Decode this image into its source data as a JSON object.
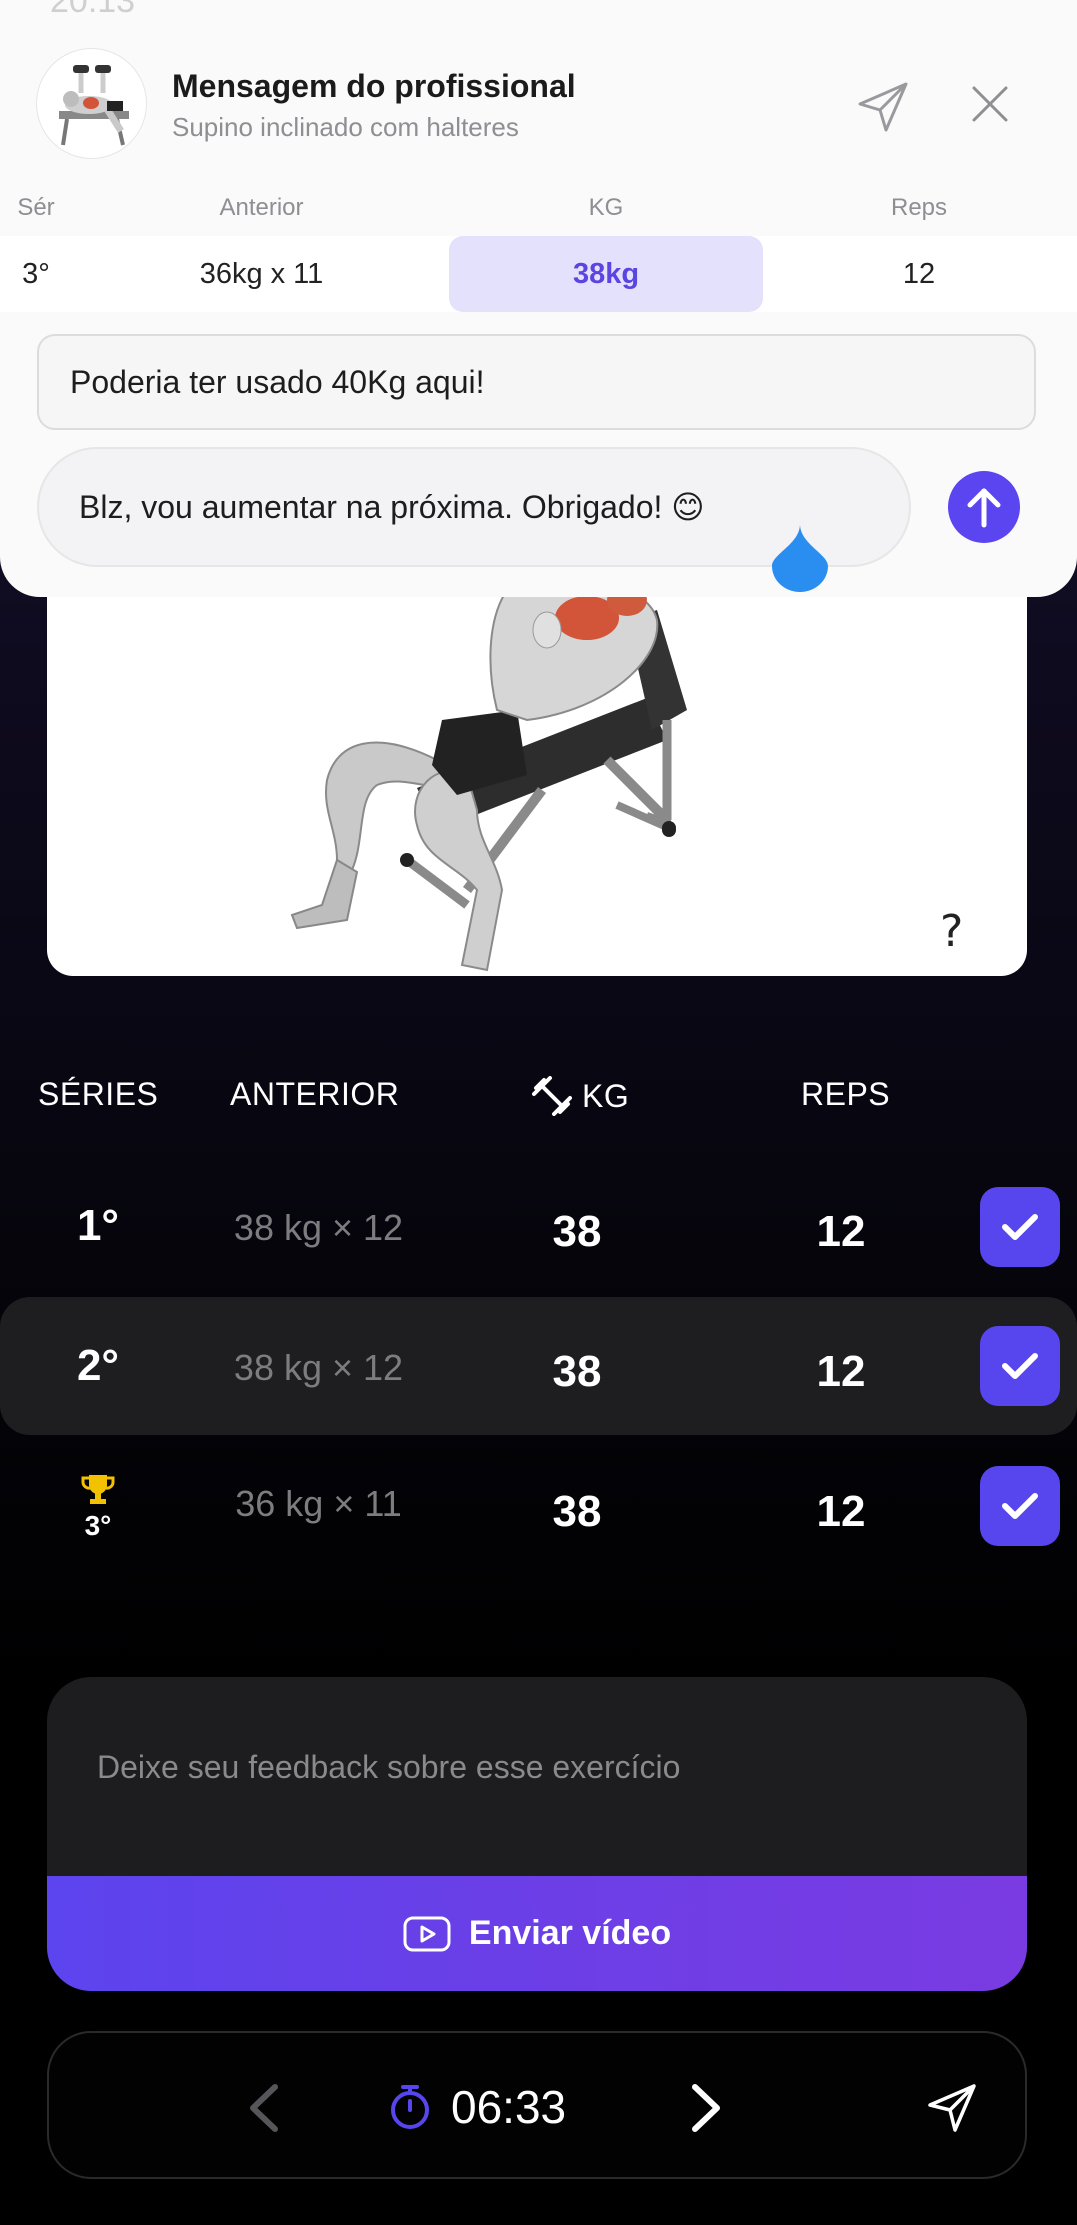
{
  "status_bar": {
    "time": "20:13"
  },
  "sheet": {
    "title": "Mensagem do profissional",
    "subtitle": "Supino inclinado com halteres",
    "table": {
      "headers": {
        "series": "Sér",
        "previous": "Anterior",
        "kg": "KG",
        "reps": "Reps"
      },
      "row": {
        "series": "3°",
        "previous": "36kg x 11",
        "kg": "38kg",
        "reps": "12"
      }
    },
    "message": "Poderia ter usado 40Kg aqui!",
    "reply": "Blz, vou aumentar na próxima. Obrigado! 😊"
  },
  "exercise": {
    "help_symbol": "?"
  },
  "sets": {
    "headers": {
      "series": "SÉRIES",
      "previous": "ANTERIOR",
      "kg": "KG",
      "reps": "REPS"
    },
    "rows": [
      {
        "series": "1°",
        "previous": "38 kg × 12",
        "kg": "38",
        "reps": "12",
        "done": true
      },
      {
        "series": "2°",
        "previous": "38 kg × 12",
        "kg": "38",
        "reps": "12",
        "done": true
      },
      {
        "series": "3°",
        "previous": "36 kg × 11",
        "kg": "38",
        "reps": "12",
        "done": true,
        "record": true
      }
    ]
  },
  "feedback": {
    "placeholder": "Deixe seu feedback sobre esse exercício",
    "video_button": "Enviar vídeo"
  },
  "bottom_nav": {
    "timer": "06:33"
  },
  "colors": {
    "accent": "#5746ee",
    "accent_light": "#e3e1fb",
    "trophy": "#f2c200",
    "cursor": "#2a8df0"
  },
  "icons": [
    "paper-plane-icon",
    "close-icon",
    "arrow-up-icon",
    "dumbbell-icon",
    "check-icon",
    "trophy-icon",
    "play-icon",
    "chevron-left-icon",
    "chevron-right-icon",
    "stopwatch-icon",
    "help-icon"
  ]
}
